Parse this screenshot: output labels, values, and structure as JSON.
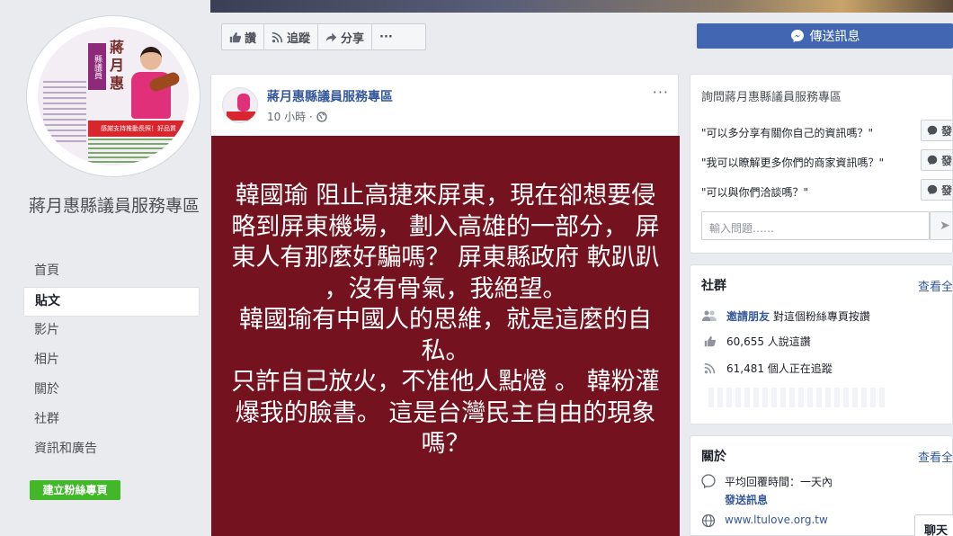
{
  "page": {
    "name": "蔣月惠縣議員服務專區",
    "avatar_text": {
      "tag": "縣議員",
      "name": "蔣月惠",
      "banner": "感謝支持推動長照！好品質",
      "sub": "縣議員選區 全屏東"
    }
  },
  "nav": {
    "items": [
      "首頁",
      "貼文",
      "影片",
      "相片",
      "關於",
      "社群",
      "資訊和廣告"
    ],
    "active_index": 1
  },
  "create_page_button": "建立粉絲專頁",
  "action_bar": {
    "like": "讚",
    "follow": "追蹤",
    "share": "分享",
    "more": "···"
  },
  "send_message_button": "傳送訊息",
  "post": {
    "author": "蔣月惠縣議員服務專區",
    "time": "10 小時 ·",
    "more": "···",
    "body": "韓國瑜 阻止高捷來屏東，現在卻想要侵略到屏東機場， 劃入高雄的一部分， 屏東人有那麼好騙嗎？ 屏東縣政府 軟趴趴 ，沒有骨氣，我絕望。\n韓國瑜有中國人的思維，就是這麼的自私。\n只許自己放火，不准他人點燈 。 韓粉灌爆我的臉書。 這是台灣民主自由的現象嗎？",
    "background_color": "#74121f"
  },
  "ask": {
    "title": "詢問蔣月惠縣議員服務專區",
    "questions": [
      "\"可以多分享有關你自己的資訊嗎？\"",
      "\"我可以瞭解更多你們的商家資訊嗎？\"",
      "\"可以與你們洽談嗎？\""
    ],
    "ask_button": "發問",
    "input_placeholder": "輸入問題……"
  },
  "community": {
    "title": "社群",
    "see_all": "查看全部",
    "invite_link": "邀請朋友",
    "invite_text": "對這個粉絲專頁按讚",
    "likes": "60,655 人說這讚",
    "follows": "61,481 個人正在追蹤"
  },
  "about": {
    "title": "關於",
    "see_all": "查看全部",
    "response": "平均回覆時間：一天內",
    "send_message": "發送訊息",
    "website": "www.ltulove.org.tw"
  },
  "chat_tab": "聊天",
  "colors": {
    "brand": "#4267b2",
    "link": "#365899",
    "green": "#42b72a"
  }
}
